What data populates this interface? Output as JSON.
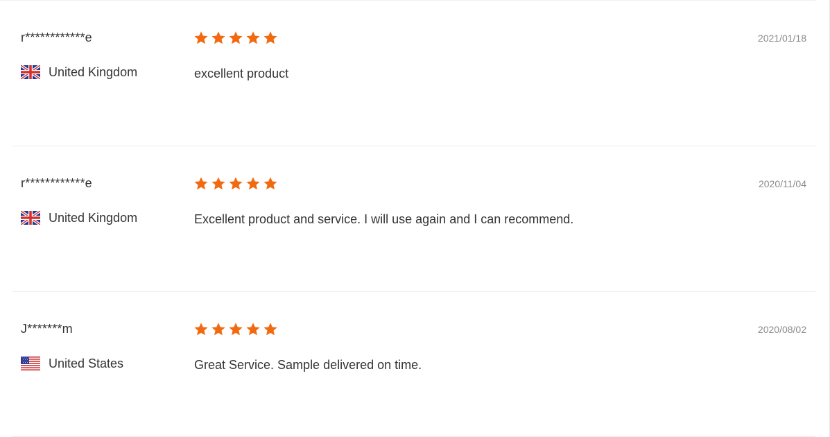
{
  "reviews": [
    {
      "reviewer": "r************e",
      "country": "United Kingdom",
      "flag_icon": "uk-flag-icon",
      "rating": 5,
      "rating_max": 5,
      "comment": "excellent product",
      "date": "2021/01/18"
    },
    {
      "reviewer": "r************e",
      "country": "United Kingdom",
      "flag_icon": "uk-flag-icon",
      "rating": 5,
      "rating_max": 5,
      "comment": "Excellent product and service. I will use again and I can recommend.",
      "date": "2020/11/04"
    },
    {
      "reviewer": "J*******m",
      "country": "United States",
      "flag_icon": "us-flag-icon",
      "rating": 5,
      "rating_max": 5,
      "comment": "Great Service. Sample delivered on time.",
      "date": "2020/08/02"
    }
  ],
  "colors": {
    "star": "#f26a10",
    "text": "#333333",
    "date": "#8a8a8a",
    "divider": "#ececec"
  }
}
